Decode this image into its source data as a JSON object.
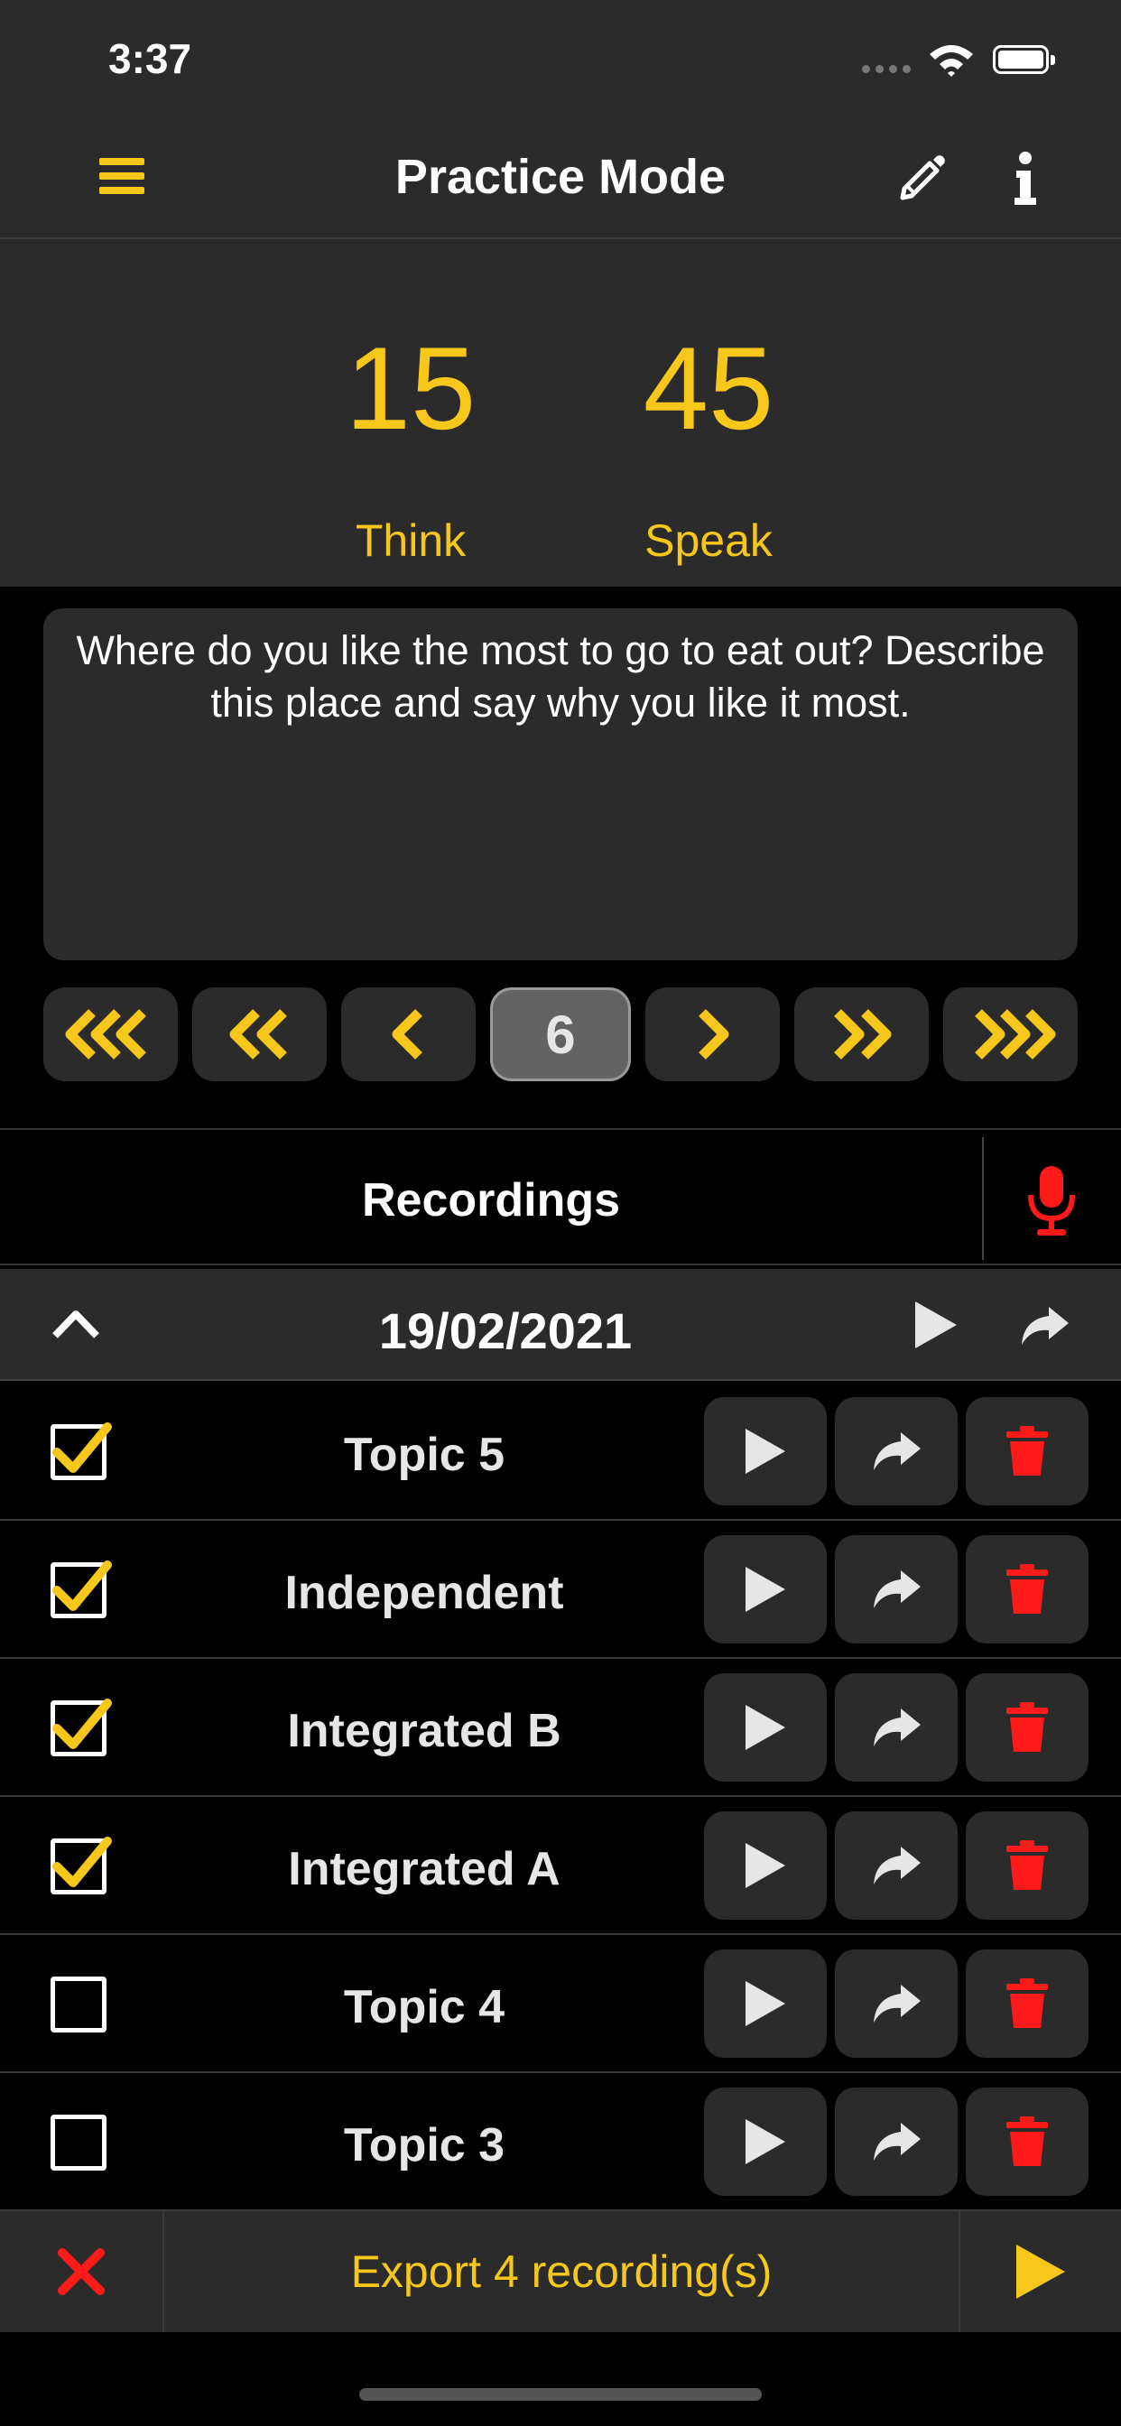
{
  "status_bar": {
    "time": "3:37"
  },
  "nav": {
    "title": "Practice Mode"
  },
  "timers": {
    "think": {
      "value": "15",
      "label": "Think"
    },
    "speak": {
      "value": "45",
      "label": "Speak"
    }
  },
  "question": {
    "text": "Where do you like the most to go to eat out? Describe this place and say why you like it most."
  },
  "pager": {
    "current_page": "6"
  },
  "recordings": {
    "title": "Recordings",
    "date": "19/02/2021",
    "items": [
      {
        "name": "Topic 5",
        "checked": true
      },
      {
        "name": "Independent",
        "checked": true
      },
      {
        "name": "Integrated B",
        "checked": true
      },
      {
        "name": "Integrated A",
        "checked": true
      },
      {
        "name": "Topic 4",
        "checked": false
      },
      {
        "name": "Topic 3",
        "checked": false
      }
    ]
  },
  "footer": {
    "export_label": "Export 4 recording(s)"
  },
  "colors": {
    "accent": "#f7c81b",
    "danger": "#ff1a1a",
    "panel": "#2b2b2b",
    "background": "#000000"
  }
}
